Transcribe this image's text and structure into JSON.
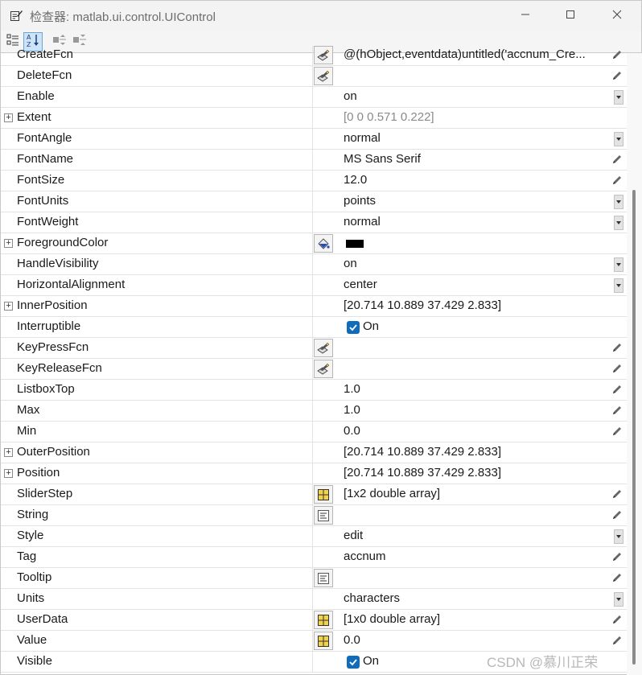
{
  "window": {
    "title": "检查器: matlab.ui.control.UIControl",
    "minimize_icon": "minimize-icon",
    "maximize_icon": "maximize-icon",
    "close_icon": "close-icon"
  },
  "toolbar": {
    "buttons": [
      {
        "name": "categorize-icon",
        "active": false
      },
      {
        "name": "sort-alpha-icon",
        "active": true
      },
      {
        "name": "expand-all-icon",
        "active": false
      },
      {
        "name": "collapse-all-icon",
        "active": false
      }
    ]
  },
  "properties": [
    {
      "name": "CreateFcn",
      "value": "@(hObject,eventdata)untitled('accnum_Cre...",
      "expandable": false,
      "editor": "callback",
      "right": "pencil"
    },
    {
      "name": "DeleteFcn",
      "value": "",
      "expandable": false,
      "editor": "callback",
      "right": "pencil"
    },
    {
      "name": "Enable",
      "value": "on",
      "expandable": false,
      "editor": "",
      "right": "dropdown"
    },
    {
      "name": "Extent",
      "value": "[0 0 0.571 0.222]",
      "expandable": true,
      "editor": "",
      "right": "",
      "grey": true
    },
    {
      "name": "FontAngle",
      "value": "normal",
      "expandable": false,
      "editor": "",
      "right": "dropdown"
    },
    {
      "name": "FontName",
      "value": "MS Sans Serif",
      "expandable": false,
      "editor": "",
      "right": "pencil"
    },
    {
      "name": "FontSize",
      "value": "12.0",
      "expandable": false,
      "editor": "",
      "right": "pencil"
    },
    {
      "name": "FontUnits",
      "value": "points",
      "expandable": false,
      "editor": "",
      "right": "dropdown"
    },
    {
      "name": "FontWeight",
      "value": "normal",
      "expandable": false,
      "editor": "",
      "right": "dropdown"
    },
    {
      "name": "ForegroundColor",
      "value": "",
      "expandable": true,
      "editor": "color",
      "right": "",
      "swatch": "#000000"
    },
    {
      "name": "HandleVisibility",
      "value": "on",
      "expandable": false,
      "editor": "",
      "right": "dropdown"
    },
    {
      "name": "HorizontalAlignment",
      "value": "center",
      "expandable": false,
      "editor": "",
      "right": "dropdown"
    },
    {
      "name": "InnerPosition",
      "value": "[20.714 10.889 37.429 2.833]",
      "expandable": true,
      "editor": "",
      "right": ""
    },
    {
      "name": "Interruptible",
      "value": "On",
      "expandable": false,
      "editor": "",
      "right": "",
      "checkbox": true
    },
    {
      "name": "KeyPressFcn",
      "value": "",
      "expandable": false,
      "editor": "callback",
      "right": "pencil"
    },
    {
      "name": "KeyReleaseFcn",
      "value": "",
      "expandable": false,
      "editor": "callback",
      "right": "pencil"
    },
    {
      "name": "ListboxTop",
      "value": "1.0",
      "expandable": false,
      "editor": "",
      "right": "pencil"
    },
    {
      "name": "Max",
      "value": "1.0",
      "expandable": false,
      "editor": "",
      "right": "pencil"
    },
    {
      "name": "Min",
      "value": "0.0",
      "expandable": false,
      "editor": "",
      "right": "pencil"
    },
    {
      "name": "OuterPosition",
      "value": "[20.714 10.889 37.429 2.833]",
      "expandable": true,
      "editor": "",
      "right": ""
    },
    {
      "name": "Position",
      "value": "[20.714 10.889 37.429 2.833]",
      "expandable": true,
      "editor": "",
      "right": ""
    },
    {
      "name": "SliderStep",
      "value": "[1x2  double array]",
      "expandable": false,
      "editor": "array",
      "right": "pencil"
    },
    {
      "name": "String",
      "value": "",
      "expandable": false,
      "editor": "text",
      "right": "pencil"
    },
    {
      "name": "Style",
      "value": "edit",
      "expandable": false,
      "editor": "",
      "right": "dropdown"
    },
    {
      "name": "Tag",
      "value": "accnum",
      "expandable": false,
      "editor": "",
      "right": "pencil"
    },
    {
      "name": "Tooltip",
      "value": "",
      "expandable": false,
      "editor": "text",
      "right": "pencil"
    },
    {
      "name": "Units",
      "value": "characters",
      "expandable": false,
      "editor": "",
      "right": "dropdown"
    },
    {
      "name": "UserData",
      "value": "[1x0  double array]",
      "expandable": false,
      "editor": "array",
      "right": "pencil"
    },
    {
      "name": "Value",
      "value": "0.0",
      "expandable": false,
      "editor": "array",
      "right": "pencil"
    },
    {
      "name": "Visible",
      "value": "On",
      "expandable": false,
      "editor": "",
      "right": "",
      "checkbox": true
    }
  ],
  "watermark": "CSDN @慕川正荣",
  "colors": {
    "checkbox": "#0f6cbd",
    "selected_toolbar": "#cfe3f7"
  }
}
